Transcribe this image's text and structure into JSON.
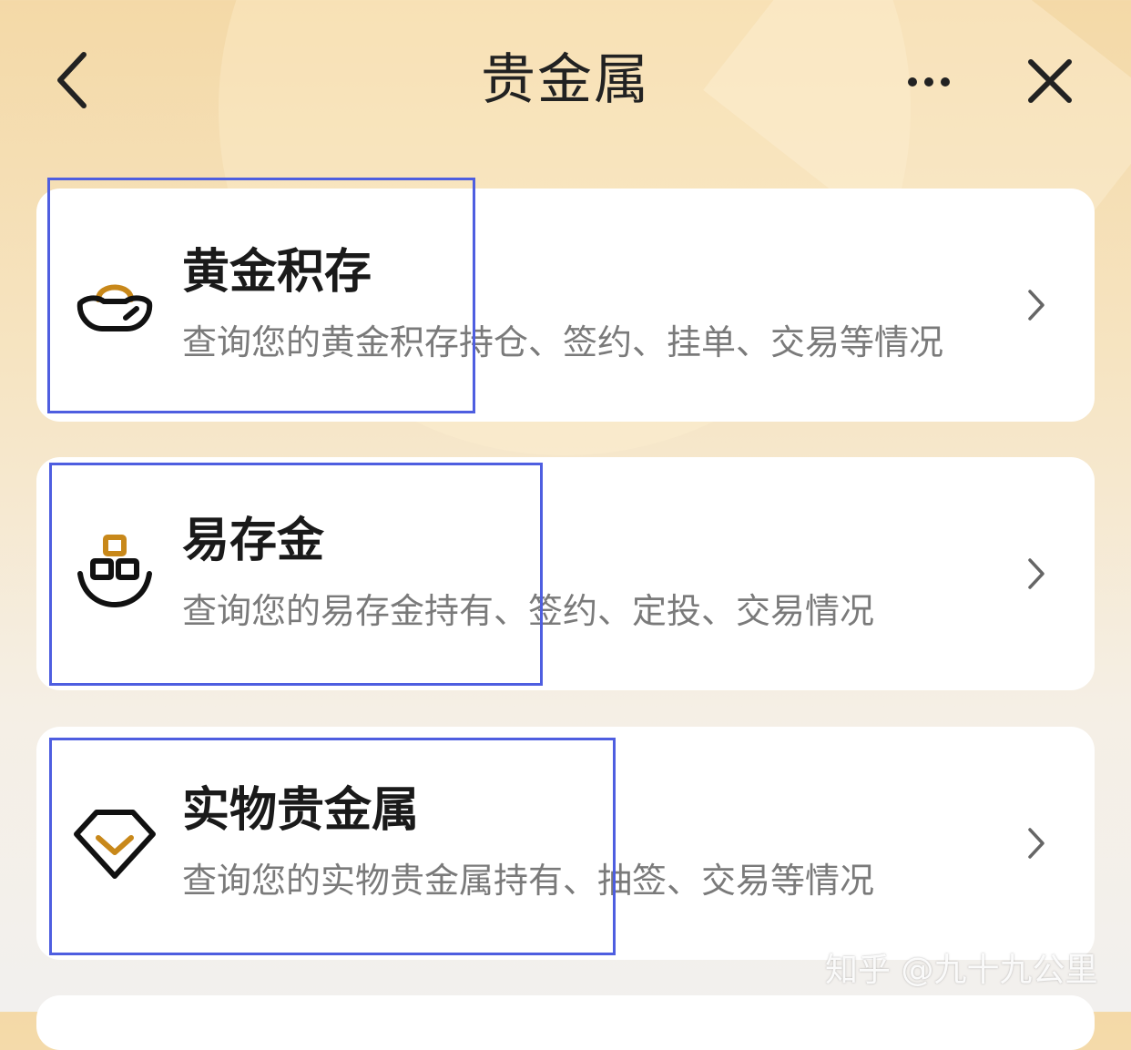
{
  "header": {
    "title": "贵金属",
    "back_icon": "chevron-left-icon",
    "more_icon": "more-horizontal-icon",
    "close_icon": "close-icon"
  },
  "items": [
    {
      "title": "黄金积存",
      "description": "查询您的黄金积存持仓、签约、挂单、交易等情况",
      "icon": "gold-ingot-icon"
    },
    {
      "title": "易存金",
      "description": "查询您的易存金持有、签约、定投、交易情况",
      "icon": "gold-bars-boat-icon"
    },
    {
      "title": "实物贵金属",
      "description": "查询您的实物贵金属持有、抽签、交易等情况",
      "icon": "diamond-icon"
    }
  ],
  "watermark": "知乎 @九十九公里",
  "colors": {
    "accent_gold": "#c8881a",
    "highlight_box": "#4e5ee0",
    "background_top": "#f4d9a7",
    "card": "#ffffff"
  }
}
